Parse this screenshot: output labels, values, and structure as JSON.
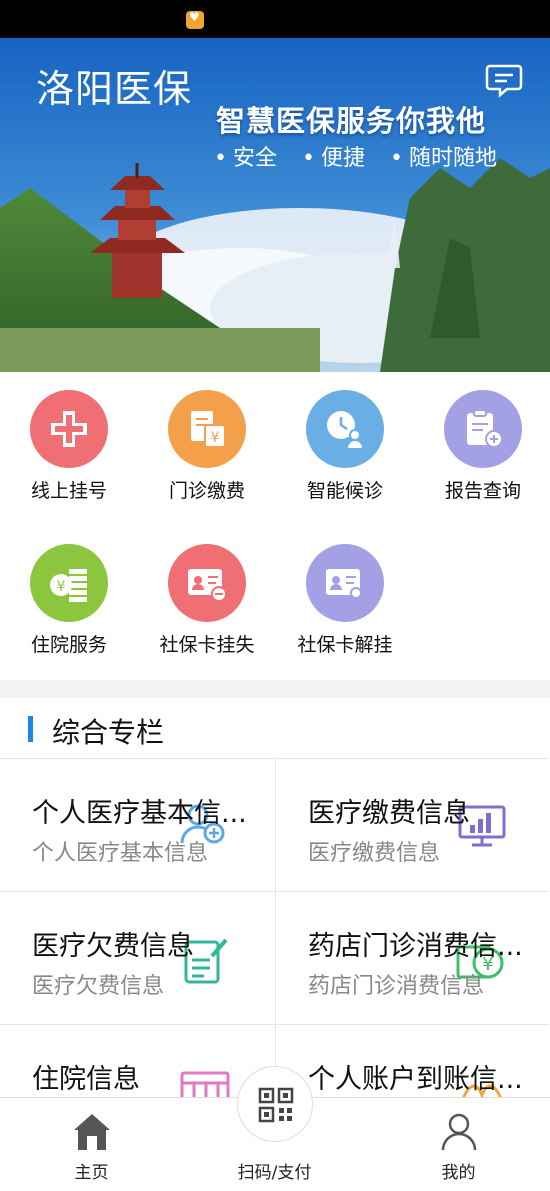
{
  "app": {
    "title": "洛阳医保"
  },
  "banner": {
    "slogan": "智慧医保服务你我他",
    "tags": [
      "安全",
      "便捷",
      "随时随地"
    ]
  },
  "services": [
    {
      "label": "线上挂号",
      "color": "#ef6f74",
      "icon": "hospital-cross-icon"
    },
    {
      "label": "门诊缴费",
      "color": "#f4a04a",
      "icon": "bill-payment-icon"
    },
    {
      "label": "智能候诊",
      "color": "#6aaee6",
      "icon": "clock-person-icon"
    },
    {
      "label": "报告查询",
      "color": "#a3a0e6",
      "icon": "report-clipboard-icon"
    },
    {
      "label": "住院服务",
      "color": "#8cc63f",
      "icon": "coin-stack-icon"
    },
    {
      "label": "社保卡挂失",
      "color": "#ef6f74",
      "icon": "card-minus-icon"
    },
    {
      "label": "社保卡解挂",
      "color": "#a3a0e6",
      "icon": "card-search-icon"
    }
  ],
  "section": {
    "title": "综合专栏"
  },
  "cards": [
    {
      "title": "个人医疗基本信...",
      "subtitle": "个人医疗基本信息",
      "icon": "person-gear-icon"
    },
    {
      "title": "医疗缴费信息",
      "subtitle": "医疗缴费信息",
      "icon": "monitor-chart-icon"
    },
    {
      "title": "医疗欠费信息",
      "subtitle": "医疗欠费信息",
      "icon": "document-pen-icon"
    },
    {
      "title": "药店门诊消费信...",
      "subtitle": "药店门诊消费信息",
      "icon": "yuan-screen-icon"
    },
    {
      "title": "住院信息",
      "subtitle": "",
      "icon": "calendar-grid-icon"
    },
    {
      "title": "个人账户到账信...",
      "subtitle": "",
      "icon": "account-icon"
    }
  ],
  "tabbar": {
    "home": "主页",
    "scan": "扫码/支付",
    "mine": "我的"
  },
  "colors": {
    "accent": "#1e88e5",
    "banner_sky": "#1d6fc9"
  }
}
